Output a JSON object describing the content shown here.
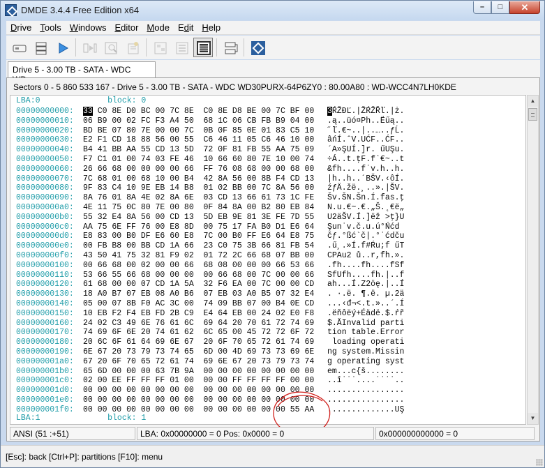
{
  "window": {
    "title": "DMDE 3.4.4 Free Edition x64",
    "controls": {
      "minimize": "–",
      "maximize": "□",
      "close": "✕"
    }
  },
  "menu": [
    {
      "pre": "",
      "u": "D",
      "post": "rive"
    },
    {
      "pre": "",
      "u": "T",
      "post": "ools"
    },
    {
      "pre": "",
      "u": "W",
      "post": "indows"
    },
    {
      "pre": "",
      "u": "E",
      "post": "ditor"
    },
    {
      "pre": "",
      "u": "M",
      "post": "ode"
    },
    {
      "pre": "E",
      "u": "d",
      "post": "it"
    },
    {
      "pre": "",
      "u": "H",
      "post": "elp"
    }
  ],
  "toolbar_icons": [
    "drive-icon",
    "partitions-icon",
    "play-icon",
    "sectors-icon",
    "search-icon",
    "reconstruct-icon",
    "cluster-map-icon",
    "file-panel-icon",
    "view-icon",
    "hex-view-icon",
    "disk-image-icon",
    "dmde-logo-icon"
  ],
  "tab": {
    "label": "Drive 5 - 3.00 TB - SATA - WDC WD..."
  },
  "sectors_line": "Sectors 0 - 5 860 533 167 - Drive 5 - 3.00 TB - SATA - WDC WD30PURX-64P6ZY0 : 80.00A80 : WD-WCC4N7LH0KDE",
  "hex": {
    "lba_header": "LBA:0              block: 0",
    "lba_footer": "LBA:1              block: 1",
    "cursor_byte": "33",
    "ascii_cursor": "3",
    "rows": [
      {
        "addr": "00000000000:",
        "hex": "   C0 8E D0 BC 00 7C 8E  C0 8E D8 BE 00 7C BF 00",
        "ascii": " ŔŽĐĽ.|ŽŔŽŘľ.|ż."
      },
      {
        "addr": "00000000010:",
        "hex": "06 B9 00 02 FC F3 A4 50  68 1C 06 CB FB B9 04 00",
        "ascii": ".ą..üó¤Ph..Ëűą.."
      },
      {
        "addr": "00000000020:",
        "hex": "BD BE 07 80 7E 00 00 7C  0B 0F 85 0E 01 83 C5 10",
        "ascii": "˝ľ.€~..|..…..ƒĹ."
      },
      {
        "addr": "00000000030:",
        "hex": "E2 F1 CD 18 88 56 00 55  C6 46 11 05 C6 46 10 00",
        "ascii": "âńÍ.ˆV.UĆF..ĆF.."
      },
      {
        "addr": "00000000040:",
        "hex": "B4 41 BB AA 55 CD 13 5D  72 0F 81 FB 55 AA 75 09",
        "ascii": "´A»ŞUÍ.]r. űUŞu."
      },
      {
        "addr": "00000000050:",
        "hex": "F7 C1 01 00 74 03 FE 46  10 66 60 80 7E 10 00 74",
        "ascii": "÷Á..t.ţF.f`€~..t"
      },
      {
        "addr": "00000000060:",
        "hex": "26 66 68 00 00 00 00 66  FF 76 08 68 00 00 68 00",
        "ascii": "&fh....f˙v.h..h."
      },
      {
        "addr": "00000000070:",
        "hex": "7C 68 01 00 68 10 00 B4  42 8A 56 00 8B F4 CD 13",
        "ascii": "|h..h..´BŠV.‹ôÍ."
      },
      {
        "addr": "00000000080:",
        "hex": "9F 83 C4 10 9E EB 14 B8  01 02 BB 00 7C 8A 56 00",
        "ascii": "źƒÄ.žë.¸..».|ŠV."
      },
      {
        "addr": "00000000090:",
        "hex": "8A 76 01 8A 4E 02 8A 6E  03 CD 13 66 61 73 1C FE",
        "ascii": "Šv.ŠN.Šn.Í.fas.ţ"
      },
      {
        "addr": "000000000a0:",
        "hex": "4E 11 75 0C 80 7E 00 80  0F 84 8A 00 B2 80 EB 84",
        "ascii": "N.u.€~.€.„Š.˛€ë„"
      },
      {
        "addr": "000000000b0:",
        "hex": "55 32 E4 8A 56 00 CD 13  5D EB 9E 81 3E FE 7D 55",
        "ascii": "U2äŠV.Í.]ëž >ţ}U"
      },
      {
        "addr": "000000000c0:",
        "hex": "AA 75 6E FF 76 00 E8 8D  00 75 17 FA B0 D1 E6 64",
        "ascii": "Şun˙v.č.u.ú°Ńćd"
      },
      {
        "addr": "000000000d0:",
        "hex": "E8 83 00 B0 DF E6 60 E8  7C 00 B0 FF E6 64 E8 75",
        "ascii": "čƒ.°ßć`č|.°˙ćdču"
      },
      {
        "addr": "000000000e0:",
        "hex": "00 FB B8 00 BB CD 1A 66  23 C0 75 3B 66 81 FB 54",
        "ascii": ".ű¸.»Í.f#Ŕu;f űT"
      },
      {
        "addr": "000000000f0:",
        "hex": "43 50 41 75 32 81 F9 02  01 72 2C 66 68 07 BB 00",
        "ascii": "CPAu2 ů..r,fh.»."
      },
      {
        "addr": "00000000100:",
        "hex": "00 66 68 00 02 00 00 66  68 08 00 00 00 66 53 66",
        "ascii": ".fh....fh....fSf"
      },
      {
        "addr": "00000000110:",
        "hex": "53 66 55 66 68 00 00 00  00 66 68 00 7C 00 00 66",
        "ascii": "SfUfh....fh.|..f"
      },
      {
        "addr": "00000000120:",
        "hex": "61 68 00 00 07 CD 1A 5A  32 F6 EA 00 7C 00 00 CD",
        "ascii": "ah...Í.Z2öę.|..Í"
      },
      {
        "addr": "00000000130:",
        "hex": "18 A0 B7 07 EB 08 A0 B6  07 EB 03 A0 B5 07 32 E4",
        "ascii": ". ·.ë. ¶.ë. µ.2ä"
      },
      {
        "addr": "00000000140:",
        "hex": "05 00 07 8B F0 AC 3C 00  74 09 BB 07 00 B4 0E CD",
        "ascii": "...‹đ¬<.t.»..´.Í"
      },
      {
        "addr": "00000000150:",
        "hex": "10 EB F2 F4 EB FD 2B C9  E4 64 EB 00 24 02 E0 F8",
        "ascii": ".ëňôëý+Éädë.$.ŕř"
      },
      {
        "addr": "00000000160:",
        "hex": "24 02 C3 49 6E 76 61 6C  69 64 20 70 61 72 74 69",
        "ascii": "$.ĂInvalid parti"
      },
      {
        "addr": "00000000170:",
        "hex": "74 69 6F 6E 20 74 61 62  6C 65 00 45 72 72 6F 72",
        "ascii": "tion table.Error"
      },
      {
        "addr": "00000000180:",
        "hex": "20 6C 6F 61 64 69 6E 67  20 6F 70 65 72 61 74 69",
        "ascii": " loading operati"
      },
      {
        "addr": "00000000190:",
        "hex": "6E 67 20 73 79 73 74 65  6D 00 4D 69 73 73 69 6E",
        "ascii": "ng system.Missin"
      },
      {
        "addr": "000000001a0:",
        "hex": "67 20 6F 70 65 72 61 74  69 6E 67 20 73 79 73 74",
        "ascii": "g operating syst"
      },
      {
        "addr": "000000001b0:",
        "hex": "65 6D 00 00 00 63 7B 9A  00 00 00 00 00 00 00 00",
        "ascii": "em...c{š........"
      },
      {
        "addr": "000000001c0:",
        "hex": "02 00 EE FF FF FF 01 00  00 00 FF FF FF FF 00 00",
        "ascii": "..î˙˙˙....˙˙˙˙.."
      },
      {
        "addr": "000000001d0:",
        "hex": "00 00 00 00 00 00 00 00  00 00 00 00 00 00 00 00",
        "ascii": "................"
      },
      {
        "addr": "000000001e0:",
        "hex": "00 00 00 00 00 00 00 00  00 00 00 00 00 00 00 00",
        "ascii": "................"
      },
      {
        "addr": "000000001f0:",
        "hex": "00 00 00 00 00 00 00 00  00 00 00 00 00 00 55 AA",
        "ascii": "..............UŞ"
      }
    ]
  },
  "status": {
    "encoding": "ANSI (51 :+51)",
    "position": "LBA: 0x00000000 = 0  Pos: 0x0000 = 0",
    "offset": "0x000000000000 = 0"
  },
  "hint": "[Esc]: back  [Ctrl+P]: partitions  [F10]: menu",
  "colors": {
    "address": "#1e9ca8",
    "annotation": "#d0201c"
  }
}
